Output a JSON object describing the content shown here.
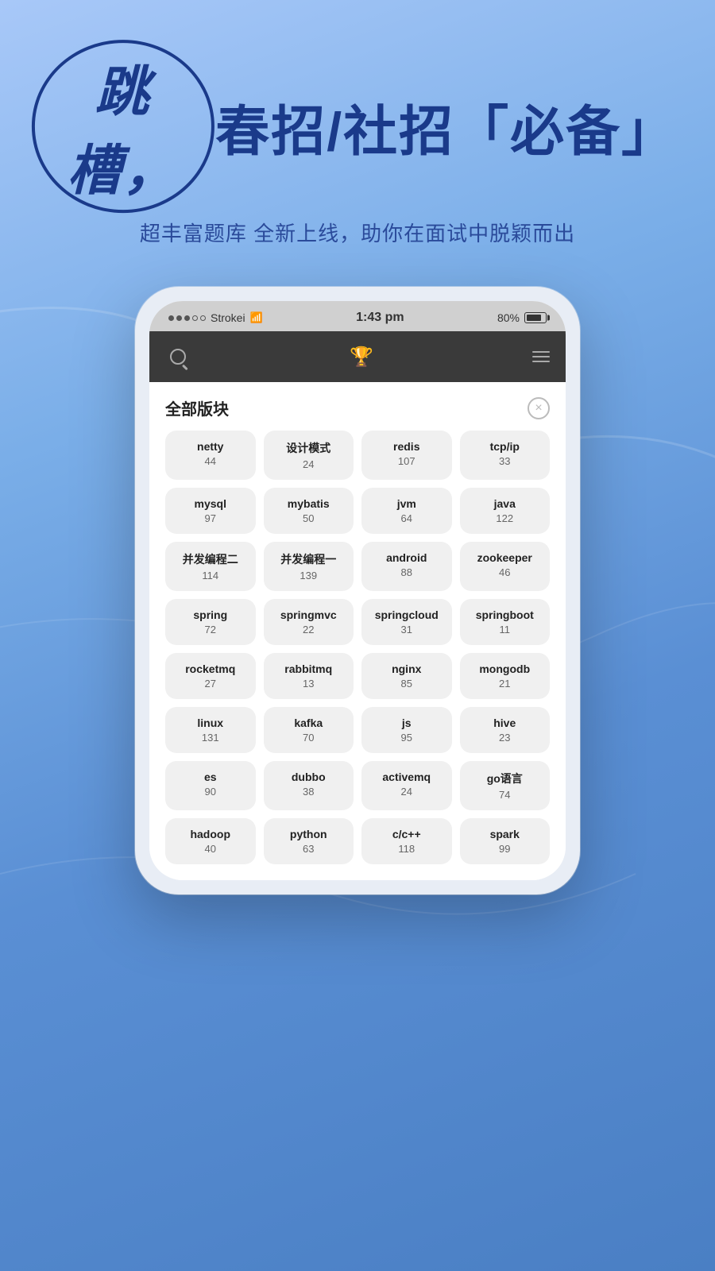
{
  "background": {
    "gradient_start": "#a8c8f8",
    "gradient_end": "#4a7fc4"
  },
  "header": {
    "title_highlight": "跳槽，",
    "title_rest": "春招/社招「必备」",
    "subtitle": "超丰富题库 全新上线，助你在面试中脱颖而出"
  },
  "status_bar": {
    "carrier": "Strokei",
    "time": "1:43 pm",
    "battery_percent": "80%"
  },
  "modal": {
    "title": "全部版块",
    "close_label": "×"
  },
  "topics": [
    {
      "name": "netty",
      "count": "44"
    },
    {
      "name": "设计模式",
      "count": "24"
    },
    {
      "name": "redis",
      "count": "107"
    },
    {
      "name": "tcp/ip",
      "count": "33"
    },
    {
      "name": "mysql",
      "count": "97"
    },
    {
      "name": "mybatis",
      "count": "50"
    },
    {
      "name": "jvm",
      "count": "64"
    },
    {
      "name": "java",
      "count": "122"
    },
    {
      "name": "并发编程二",
      "count": "114"
    },
    {
      "name": "并发编程一",
      "count": "139"
    },
    {
      "name": "android",
      "count": "88"
    },
    {
      "name": "zookeeper",
      "count": "46"
    },
    {
      "name": "spring",
      "count": "72"
    },
    {
      "name": "springmvc",
      "count": "22"
    },
    {
      "name": "springcloud",
      "count": "31"
    },
    {
      "name": "springboot",
      "count": "11"
    },
    {
      "name": "rocketmq",
      "count": "27"
    },
    {
      "name": "rabbitmq",
      "count": "13"
    },
    {
      "name": "nginx",
      "count": "85"
    },
    {
      "name": "mongodb",
      "count": "21"
    },
    {
      "name": "linux",
      "count": "131"
    },
    {
      "name": "kafka",
      "count": "70"
    },
    {
      "name": "js",
      "count": "95"
    },
    {
      "name": "hive",
      "count": "23"
    },
    {
      "name": "es",
      "count": "90"
    },
    {
      "name": "dubbo",
      "count": "38"
    },
    {
      "name": "activemq",
      "count": "24"
    },
    {
      "name": "go语言",
      "count": "74"
    },
    {
      "name": "hadoop",
      "count": "40"
    },
    {
      "name": "python",
      "count": "63"
    },
    {
      "name": "c/c++",
      "count": "118"
    },
    {
      "name": "spark",
      "count": "99"
    }
  ]
}
